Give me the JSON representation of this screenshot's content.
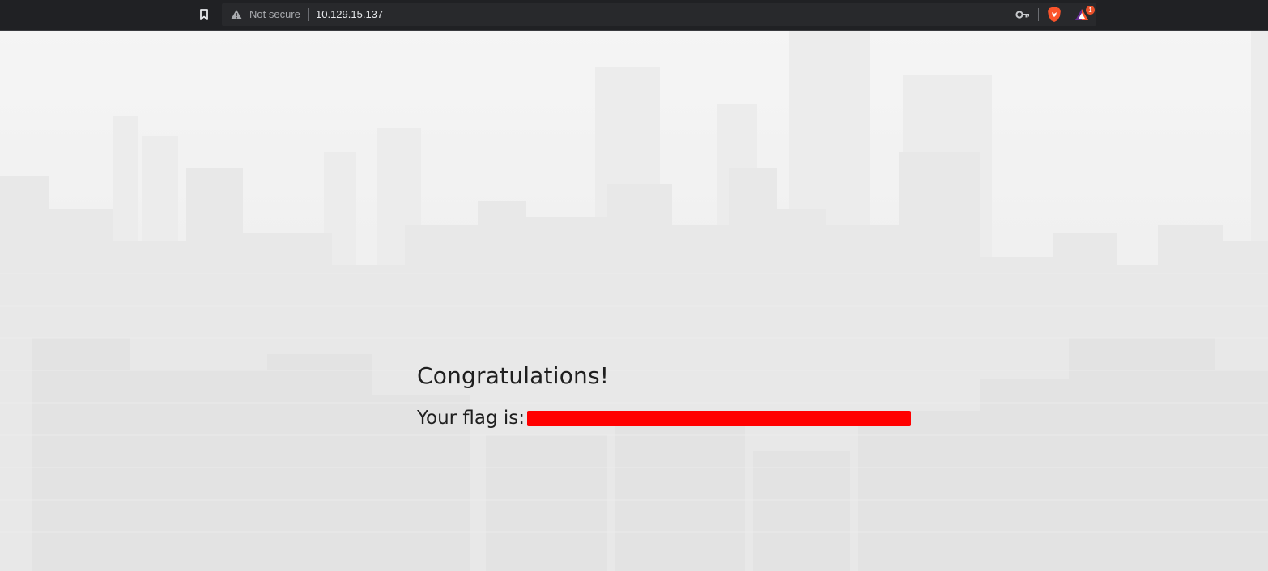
{
  "browser": {
    "security_label": "Not secure",
    "url": "10.129.15.137",
    "rewards_badge_count": "1",
    "icons": {
      "bookmark": "bookmark-icon",
      "warning": "warning-triangle-icon",
      "key": "key-icon",
      "brave": "brave-lion-icon",
      "rewards": "brave-rewards-triangle-icon"
    },
    "colors": {
      "toolbar_bg": "#202124",
      "address_bg": "#28292c",
      "brave_orange": "#fb542b",
      "badge": "#e8512b"
    }
  },
  "page": {
    "heading": "Congratulations!",
    "flag_label": "Your flag is:",
    "flag_redaction_color": "#ff0000"
  }
}
